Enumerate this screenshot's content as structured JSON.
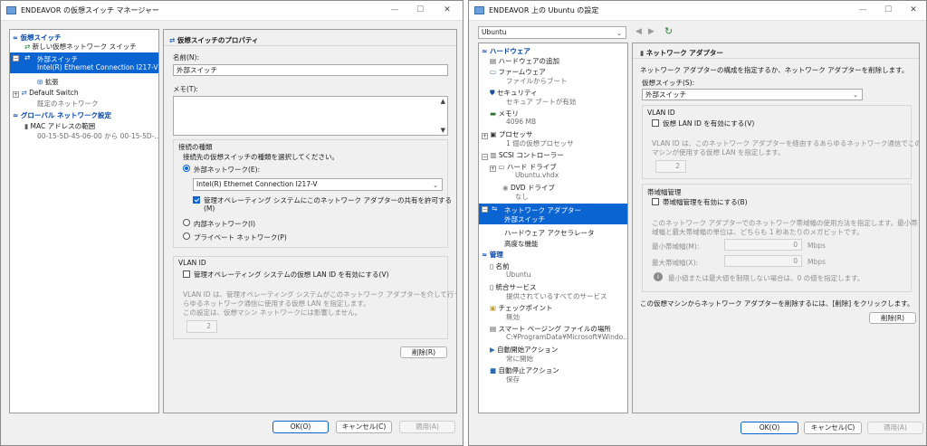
{
  "left_window": {
    "title": "ENDEAVOR の仮想スイッチ マネージャー",
    "tree": {
      "section_virtual_switch": "仮想スイッチ",
      "new_switch": "新しい仮想ネットワーク スイッチ",
      "external_switch": "外部スイッチ",
      "external_switch_sub": "Intel(R) Ethernet Connection I217-V",
      "extension": "拡張",
      "default_switch": "Default Switch",
      "default_switch_sub": "既定のネットワーク",
      "section_global": "グローバル ネットワーク設定",
      "mac_range": "MAC アドレスの範囲",
      "mac_range_sub": "00-15-5D-45-06-00 から 00-15-5D-..."
    },
    "props": {
      "heading": "仮想スイッチのプロパティ",
      "name_label": "名前(N):",
      "name_value": "外部スイッチ",
      "memo_label": "メモ(T):",
      "conn_group_title": "接続の種類",
      "conn_desc": "接続先の仮想スイッチの種類を選択してください。",
      "radio_external": "外部ネットワーク(E):",
      "adapter_value": "Intel(R) Ethernet Connection I217-V",
      "allow_share_line1": "管理オペレーティング システムにこのネットワーク アダプターの共有を許可する",
      "allow_share_line2": "(M)",
      "radio_internal": "内部ネットワーク(I)",
      "radio_private": "プライベート ネットワーク(P)",
      "vlan_title": "VLAN ID",
      "vlan_checkbox": "管理オペレーティング システムの仮想 LAN ID を有効にする(V)",
      "vlan_desc1": "VLAN ID は、管理オペレーティング システムがこのネットワーク アダプターを介して行うあ",
      "vlan_desc2": "らゆるネットワーク通信に使用する仮想 LAN を指定します。",
      "vlan_desc3": "この設定は、仮想マシン ネットワークには影響しません。",
      "vlan_value": "2",
      "remove_button": "削除(R)"
    },
    "buttons": {
      "ok": "OK(O)",
      "cancel": "キャンセル(C)",
      "apply": "適用(A)"
    }
  },
  "right_window": {
    "title": "ENDEAVOR 上の Ubuntu の設定",
    "vm_select": "Ubuntu",
    "tree": {
      "section_hardware": "ハードウェア",
      "add_hardware": "ハードウェアの追加",
      "firmware": "ファームウェア",
      "firmware_sub": "ファイルからブート",
      "security": "セキュリティ",
      "security_sub": "セキュア ブートが有効",
      "memory": "メモリ",
      "memory_sub": "4096 MB",
      "processor": "プロセッサ",
      "processor_sub": "1 個の仮想プロセッサ",
      "scsi": "SCSI コントローラー",
      "hard_drive": "ハード ドライブ",
      "hard_drive_sub": "Ubuntu.vhdx",
      "dvd_drive": "DVD ドライブ",
      "dvd_drive_sub": "なし",
      "network_adapter": "ネットワーク アダプター",
      "network_adapter_sub": "外部スイッチ",
      "hw_accel": "ハードウェア アクセラレータ",
      "advanced": "高度な機能",
      "section_management": "管理",
      "name": "名前",
      "name_sub": "Ubuntu",
      "integration": "統合サービス",
      "integration_sub": "提供されているすべてのサービス",
      "checkpoint": "チェックポイント",
      "checkpoint_sub": "無効",
      "paging": "スマート ページング ファイルの場所",
      "paging_sub": "C:¥ProgramData¥Microsoft¥Windo...",
      "auto_start": "自動開始アクション",
      "auto_start_sub": "常に開始",
      "auto_stop": "自動停止アクション",
      "auto_stop_sub": "保存"
    },
    "props": {
      "heading": "ネットワーク アダプター",
      "desc": "ネットワーク アダプターの構成を指定するか、ネットワーク アダプターを削除します。",
      "switch_label": "仮想スイッチ(S):",
      "switch_value": "外部スイッチ",
      "vlan_title": "VLAN ID",
      "vlan_checkbox": "仮想 LAN ID を有効にする(V)",
      "vlan_desc1": "VLAN ID は、このネットワーク アダプターを経由するあらゆるネットワーク通信でこの仮想",
      "vlan_desc2": "マシンが使用する仮想 LAN を指定します。",
      "vlan_value": "2",
      "bw_title": "帯域幅管理",
      "bw_checkbox": "帯域幅管理を有効にする(B)",
      "bw_desc1": "このネットワーク アダプターでのネットワーク帯域幅の使用方法を指定します。最小帯",
      "bw_desc2": "域幅と最大帯域幅の単位は、どちらも 1 秒あたりのメガビットです。",
      "min_label": "最小帯域幅(M):",
      "min_value": "0",
      "min_unit": "Mbps",
      "max_label": "最大帯域幅(X):",
      "max_value": "0",
      "max_unit": "Mbps",
      "info_text": "最小値または最大値を制限しない場合は、0 の値を指定します。",
      "remove_desc": "この仮想マシンからネットワーク アダプターを削除するには、[削除] をクリックします。",
      "remove_button": "削除(R)"
    },
    "buttons": {
      "ok": "OK(O)",
      "cancel": "キャンセル(C)",
      "apply": "適用(A)"
    }
  },
  "colors": {
    "selection": "#0a64d2",
    "section_header": "#0042a8",
    "window_bg": "#f0f0f0"
  },
  "icons": [
    "switch-icon",
    "network-icon",
    "plug-icon",
    "shield-icon",
    "memory-icon",
    "cpu-icon",
    "disk-icon",
    "dvd-icon",
    "info-icon",
    "refresh-icon"
  ]
}
